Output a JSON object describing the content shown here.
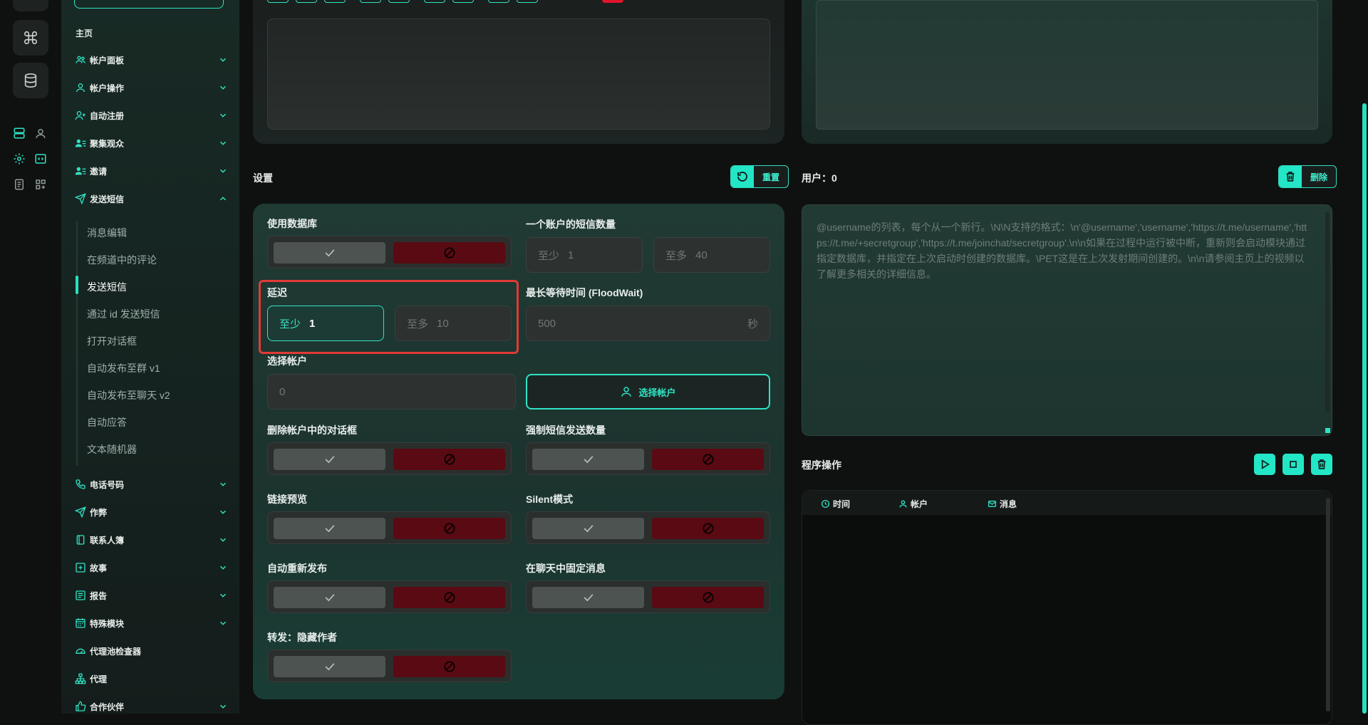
{
  "sidebar": {
    "home": "主页",
    "items": [
      {
        "label": "帐户面板",
        "icon": "users-icon",
        "expanded": false
      },
      {
        "label": "帐户操作",
        "icon": "user-icon",
        "expanded": false
      },
      {
        "label": "自动注册",
        "icon": "user-plus-icon",
        "expanded": false
      },
      {
        "label": "聚集观众",
        "icon": "user-list-icon",
        "expanded": false
      },
      {
        "label": "邀请",
        "icon": "user-list-icon",
        "expanded": false
      },
      {
        "label": "发送短信",
        "icon": "send-icon",
        "expanded": true
      }
    ],
    "sub_items": [
      "消息编辑",
      "在频道中的评论",
      "发送短信",
      "通过 id 发送短信",
      "打开对话框",
      "自动发布至群 v1",
      "自动发布至聊天 v2",
      "自动应答",
      "文本随机器"
    ],
    "active_sub": "发送短信",
    "items_bottom": [
      {
        "label": "电话号码",
        "icon": "phone-icon"
      },
      {
        "label": "作弊",
        "icon": "send-check-icon"
      },
      {
        "label": "联系人簿",
        "icon": "book-icon"
      },
      {
        "label": "故事",
        "icon": "plus-square-icon"
      },
      {
        "label": "报告",
        "icon": "report-icon"
      },
      {
        "label": "特殊模块",
        "icon": "calendar-icon"
      },
      {
        "label": "代理池检查器",
        "icon": "gauge-icon"
      },
      {
        "label": "代理",
        "icon": "network-icon"
      },
      {
        "label": "合作伙伴",
        "icon": "thumbs-up-icon"
      }
    ]
  },
  "settings": {
    "title": "设置",
    "reset_label": "重置",
    "use_db_label": "使用数据库",
    "sms_per_account_label": "一个账户的短信数量",
    "sms_min_prefix": "至少",
    "sms_min_value": "1",
    "sms_max_prefix": "至多",
    "sms_max_value": "40",
    "delay_label": "延迟",
    "delay_min_prefix": "至少",
    "delay_min_value": "1",
    "delay_max_prefix": "至多",
    "delay_max_value": "10",
    "floodwait_label": "最长等待时间 (FloodWait)",
    "floodwait_value": "500",
    "floodwait_unit": "秒",
    "select_accounts_label": "选择帐户",
    "select_accounts_value": "0",
    "select_accounts_button": "选择帐户",
    "delete_dialogs_label": "删除帐户中的对话框",
    "force_count_label": "强制短信发送数量",
    "link_preview_label": "链接预览",
    "silent_label": "Silent模式",
    "auto_repost_label": "自动重新发布",
    "pin_label": "在聊天中固定消息",
    "forward_label": "转发：隐藏作者"
  },
  "users": {
    "title": "用户：0",
    "delete_label": "删除",
    "placeholder": "@username的列表，每个从一个新行。\\N\\N支持的格式：\\n'@username','username','https://t.me/username','https://t.me/+secretgroup','https://t.me/joinchat/secretgroup'.\\n\\n如果在过程中运行被中断，重新则会启动模块通过指定数据库，并指定在上次启动时创建的数据库。\\PET这是在上次发射期间创建的。\\n\\n请参阅主页上的视频以了解更多相关的详细信息。"
  },
  "program": {
    "title": "程序操作",
    "columns": [
      "时间",
      "帐户",
      "消息"
    ]
  },
  "colors": {
    "accent": "#23e6c6",
    "danger": "#5a0a12",
    "highlight": "#e23a36"
  }
}
